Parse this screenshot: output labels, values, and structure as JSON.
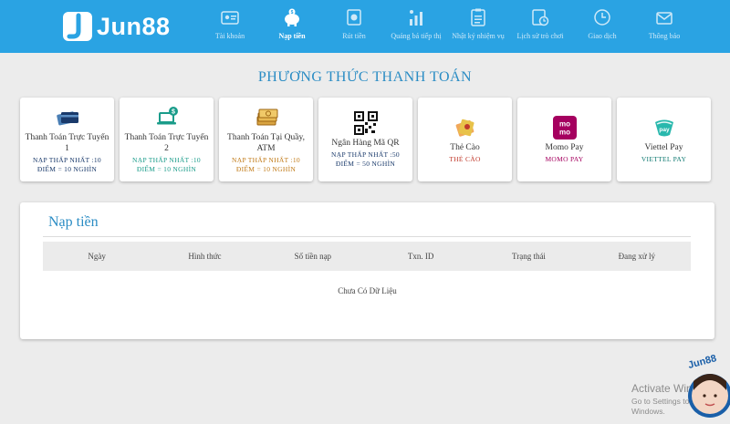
{
  "brand": {
    "name": "Jun88",
    "color": "#2aa3e3"
  },
  "nav": [
    {
      "label": "Tài khoản",
      "icon": "id-card-icon",
      "active": false
    },
    {
      "label": "Nạp tiền",
      "icon": "piggy-bank-icon",
      "active": true
    },
    {
      "label": "Rút tiền",
      "icon": "withdraw-icon",
      "active": false
    },
    {
      "label": "Quảng bá tiếp thị",
      "icon": "promotion-icon",
      "active": false
    },
    {
      "label": "Nhật ký nhiệm vụ",
      "icon": "clipboard-icon",
      "active": false
    },
    {
      "label": "Lịch sử trò chơi",
      "icon": "history-icon",
      "active": false
    },
    {
      "label": "Giao dịch",
      "icon": "clock-icon",
      "active": false
    },
    {
      "label": "Thông báo",
      "icon": "envelope-icon",
      "active": false
    }
  ],
  "page_title": "PHƯƠNG THỨC THANH TOÁN",
  "methods": [
    {
      "name": "Thanh Toán Trực Tuyến 1",
      "sub1": "NẠP THẤP NHẤT :10",
      "sub2": "ĐIỂM = 10 NGHÌN",
      "icon": "credit-card-icon",
      "color": "#1a3a6b"
    },
    {
      "name": "Thanh Toán Trực Tuyến 2",
      "sub1": "NẠP THẤP NHẤT :10",
      "sub2": "ĐIỂM = 10 NGHÌN",
      "icon": "laptop-dollar-icon",
      "color": "#1a9c8a"
    },
    {
      "name": "Thanh Toán Tại Quầy, ATM",
      "sub1": "NẠP THẤP NHẤT :10",
      "sub2": "ĐIỂM = 10 NGHÌN",
      "icon": "cash-stack-icon",
      "color": "#c17a17"
    },
    {
      "name": "Ngân Hàng Mã QR",
      "sub1": "NẠP THẤP NHẤT :50",
      "sub2": "ĐIỂM = 50 NGHÌN",
      "icon": "qr-code-icon",
      "color": "#1a3a6b"
    },
    {
      "name": "Thẻ Cào",
      "sub1": "THẺ CÀO",
      "sub2": "",
      "icon": "scratch-card-icon",
      "color": "#c0392b"
    },
    {
      "name": "Momo Pay",
      "sub1": "MOMO PAY",
      "sub2": "",
      "icon": "momo-icon",
      "color": "#a5005f"
    },
    {
      "name": "Viettel Pay",
      "sub1": "VIETTEL PAY",
      "sub2": "",
      "icon": "viettel-pay-icon",
      "color": "#117a72"
    }
  ],
  "deposit": {
    "title": "Nạp tiền",
    "columns": [
      "Ngày",
      "Hình thức",
      "Số tiền nạp",
      "Txn. ID",
      "Trạng thái",
      "Đang xử lý"
    ],
    "empty_text": "Chưa Có Dữ Liệu"
  },
  "watermark": {
    "line1": "Activate Windows",
    "line2": "Go to Settings to activate Windows."
  },
  "mascot_text": "Jun88"
}
